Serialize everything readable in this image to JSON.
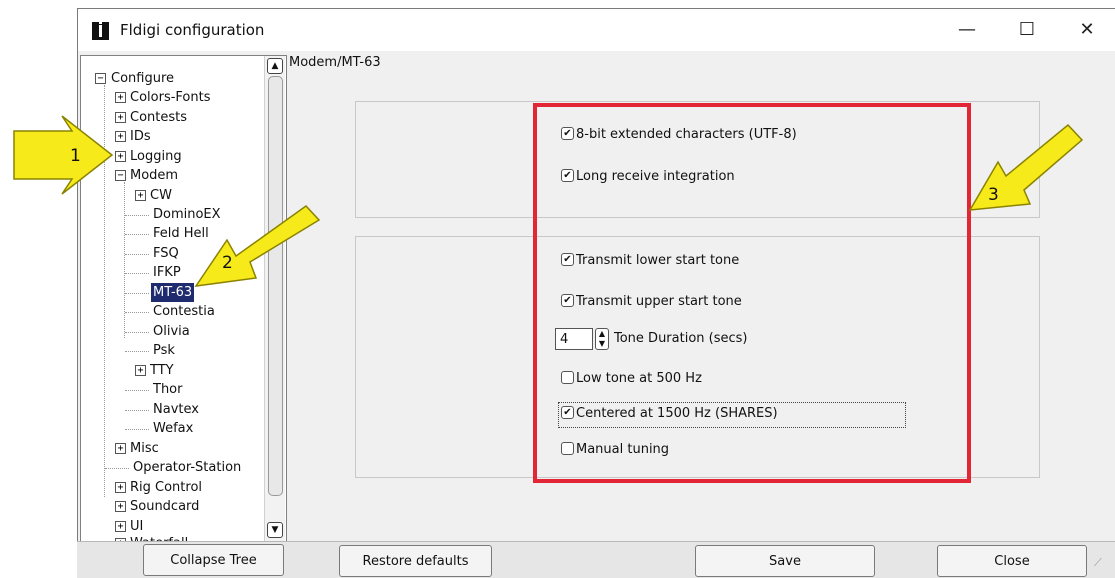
{
  "window": {
    "title": "Fldigi configuration"
  },
  "window_controls": {
    "minimize": "—",
    "maximize": "☐",
    "close": "✕"
  },
  "tree": {
    "scroll_up": "▲",
    "scroll_down": "▼",
    "items": [
      {
        "label": "Configure",
        "expander": "−"
      },
      {
        "label": "Colors-Fonts",
        "expander": "+"
      },
      {
        "label": "Contests",
        "expander": "+"
      },
      {
        "label": "IDs",
        "expander": "+"
      },
      {
        "label": "Logging",
        "expander": "+"
      },
      {
        "label": "Modem",
        "expander": "−"
      },
      {
        "label": "CW",
        "expander": "+"
      },
      {
        "label": "DominoEX"
      },
      {
        "label": "Feld Hell"
      },
      {
        "label": "FSQ"
      },
      {
        "label": "IFKP"
      },
      {
        "label": "MT-63"
      },
      {
        "label": "Contestia"
      },
      {
        "label": "Olivia"
      },
      {
        "label": "Psk"
      },
      {
        "label": "TTY",
        "expander": "+"
      },
      {
        "label": "Thor"
      },
      {
        "label": "Navtex"
      },
      {
        "label": "Wefax"
      },
      {
        "label": "Misc",
        "expander": "+"
      },
      {
        "label": "Operator-Station"
      },
      {
        "label": "Rig Control",
        "expander": "+"
      },
      {
        "label": "Soundcard",
        "expander": "+"
      },
      {
        "label": "UI",
        "expander": "+"
      },
      {
        "label": "Waterfall",
        "expander": "+"
      }
    ],
    "selected_index": 11
  },
  "breadcrumb": "Modem/MT-63",
  "options": {
    "check_mark": "✔",
    "extended_chars": {
      "label": "8-bit extended characters (UTF-8)",
      "checked": true
    },
    "long_receive": {
      "label": "Long receive integration",
      "checked": true
    },
    "tx_lower_tone": {
      "label": "Transmit lower start tone",
      "checked": true
    },
    "tx_upper_tone": {
      "label": "Transmit upper start tone",
      "checked": true
    },
    "tone_duration": {
      "label": "Tone Duration (secs)",
      "value": "4",
      "spin_up": "▲",
      "spin_down": "▼"
    },
    "low_tone_500": {
      "label": "Low tone at 500 Hz",
      "checked": false
    },
    "centered_1500": {
      "label": "Centered at 1500 Hz (SHARES)",
      "checked": true
    },
    "manual_tuning": {
      "label": "Manual tuning",
      "checked": false
    }
  },
  "buttons": {
    "collapse_tree": "Collapse Tree",
    "restore_defaults": "Restore defaults",
    "save": "Save",
    "close": "Close"
  },
  "resize_grip": "⟋",
  "annotations": {
    "arrow_1": "1",
    "arrow_2": "2",
    "arrow_3": "3"
  },
  "colors": {
    "highlight_border": "#e32636",
    "arrow_fill": "#f7ea1a",
    "selection": "#1e2b6e"
  }
}
